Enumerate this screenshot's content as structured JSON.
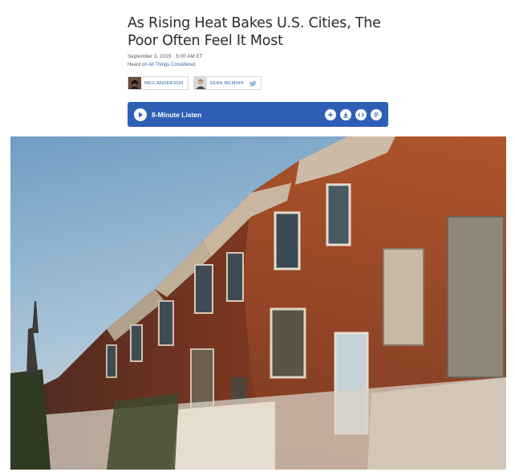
{
  "article": {
    "headline": "As Rising Heat Bakes U.S. Cities, The Poor Often Feel It Most",
    "dateline": "September 3, 2019 · 5:00 AM ET",
    "heard_prefix": "Heard on",
    "heard_show": "All Things Considered"
  },
  "bylines": [
    {
      "name": "MEG ANDERSON"
    },
    {
      "name": "SEAN MCMINN",
      "social_icon": "twitter-icon"
    }
  ],
  "player": {
    "label": "8-Minute Listen",
    "actions": [
      "add-icon",
      "download-icon",
      "embed-icon",
      "transcript-icon"
    ]
  },
  "photo": {
    "subject": "row of boarded-up brick rowhouses at sunset"
  },
  "colors": {
    "player_bg": "#2d5fb5",
    "link": "#3366aa",
    "brick": "#8a3e24"
  }
}
